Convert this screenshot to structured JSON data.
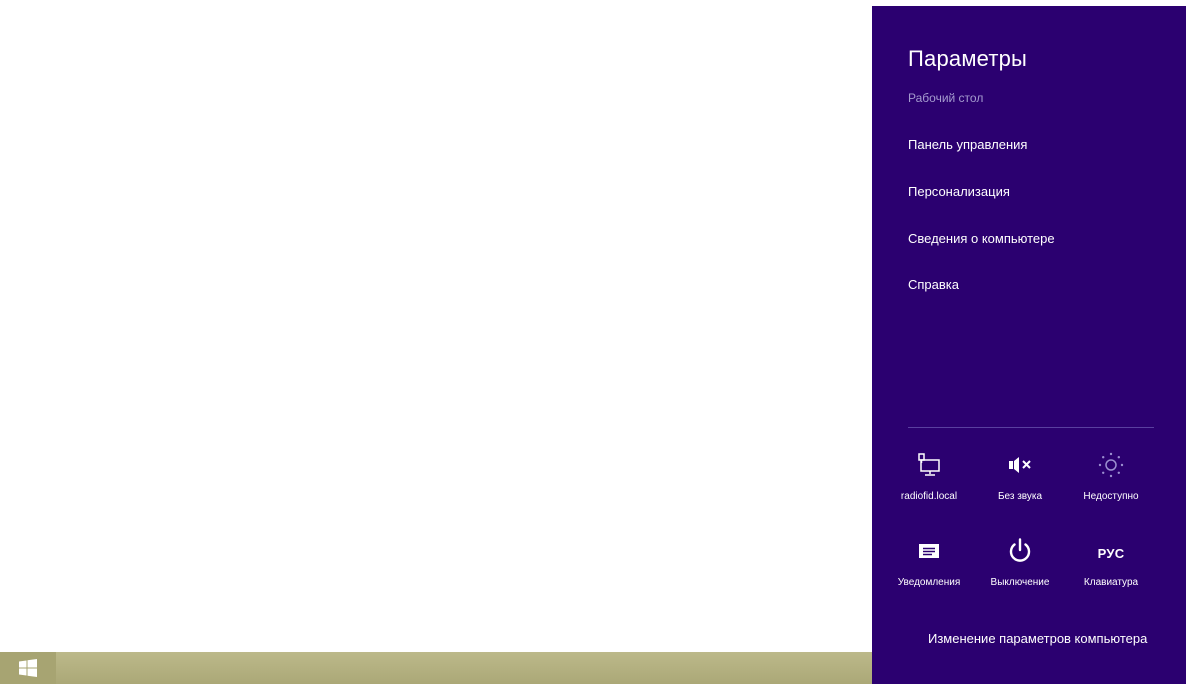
{
  "taskbar": {
    "start_icon": "windows-logo-icon",
    "color": "#b2af7e"
  },
  "charm": {
    "background": "#2b0070",
    "title": "Параметры",
    "subtitle": "Рабочий стол",
    "menu": [
      {
        "label": "Панель управления"
      },
      {
        "label": "Персонализация"
      },
      {
        "label": "Сведения о компьютере"
      },
      {
        "label": "Справка"
      }
    ],
    "tiles": [
      {
        "label": "radiofid.local",
        "icon": "network-icon"
      },
      {
        "label": "Без звука",
        "icon": "volume-muted-icon"
      },
      {
        "label": "Недоступно",
        "icon": "brightness-icon"
      },
      {
        "label": "Уведомления",
        "icon": "notifications-icon"
      },
      {
        "label": "Выключение",
        "icon": "power-icon"
      },
      {
        "label": "Клавиатура",
        "icon": "keyboard-icon",
        "icon_text": "РУС"
      }
    ],
    "change_settings": "Изменение параметров компьютера"
  }
}
